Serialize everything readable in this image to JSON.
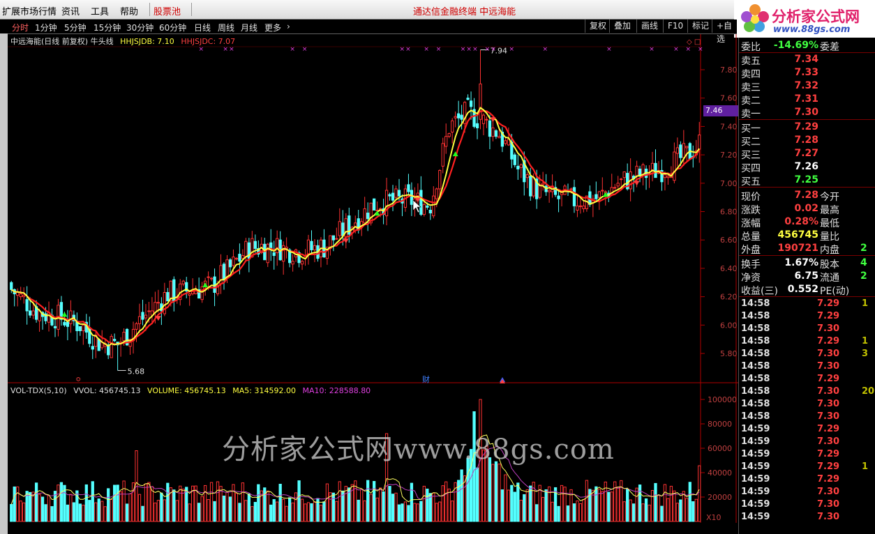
{
  "menubar": {
    "items": [
      "扩展市场行情",
      "资讯",
      "工具",
      "帮助"
    ],
    "stock_pool": "股票池",
    "title": "通达信金融终端  中远海能"
  },
  "logo": {
    "line1": "分析家公式网",
    "line2": "www.88gs.com"
  },
  "periods": [
    "分时",
    "1分钟",
    "5分钟",
    "15分钟",
    "30分钟",
    "60分钟",
    "日线",
    "周线",
    "月线",
    "更多"
  ],
  "toolbar_buttons": [
    "复权",
    "叠加",
    "画线",
    "F10",
    "标记",
    "+自选"
  ],
  "chart_info": {
    "name": "中远海能(日线 前复权) 牛头线",
    "hh_label": "HHJSJDB: 7.10",
    "hc_label": "HHJSJDC: 7.07"
  },
  "vol_info": {
    "name": "VOL-TDX(5,10)",
    "vvol": "VVOL: 456745.13",
    "volume": "VOLUME: 456745.13",
    "ma5": "MA5: 314592.00",
    "ma10": "MA10: 228588.80"
  },
  "price_axis": [
    "7.80",
    "7.60",
    "7.40",
    "7.20",
    "7.00",
    "6.80",
    "6.60",
    "6.40",
    "6.20",
    "6.00",
    "5.80"
  ],
  "vol_axis": [
    "100000",
    "80000",
    "60000",
    "40000",
    "20000"
  ],
  "vol_unit": "X10",
  "price_tag": "7.46",
  "annotations": {
    "high": "7.94",
    "low": "5.68",
    "cai": "财"
  },
  "watermark": "分析家公式网www.88gs.com",
  "quote": {
    "weibi_label": "委比",
    "weibi_value": "-14.69%",
    "weicha_label": "委差",
    "asks": [
      {
        "label": "卖五",
        "price": "7.34"
      },
      {
        "label": "卖四",
        "price": "7.33"
      },
      {
        "label": "卖三",
        "price": "7.32"
      },
      {
        "label": "卖二",
        "price": "7.31"
      },
      {
        "label": "卖一",
        "price": "7.30"
      }
    ],
    "bids": [
      {
        "label": "买一",
        "price": "7.29"
      },
      {
        "label": "买二",
        "price": "7.28"
      },
      {
        "label": "买三",
        "price": "7.27"
      },
      {
        "label": "买四",
        "price": "7.26"
      },
      {
        "label": "买五",
        "price": "7.25"
      }
    ],
    "stats": [
      {
        "l": "现价",
        "v": "7.28",
        "l2": "今开",
        "v2": ""
      },
      {
        "l": "涨跌",
        "v": "0.02",
        "l2": "最高",
        "v2": ""
      },
      {
        "l": "涨幅",
        "v": "0.28%",
        "l2": "最低",
        "v2": ""
      },
      {
        "l": "总量",
        "v": "456745",
        "l2": "量比",
        "v2": ""
      },
      {
        "l": "外盘",
        "v": "190721",
        "l2": "内盘",
        "v2": "2"
      },
      {
        "l": "换手",
        "v": "1.67%",
        "l2": "股本",
        "v2": "4"
      },
      {
        "l": "净资",
        "v": "6.75",
        "l2": "流通",
        "v2": "2"
      },
      {
        "l": "收益(三)",
        "v": "0.552",
        "l2": "PE(动)",
        "v2": ""
      }
    ],
    "ticks": [
      {
        "t": "14:58",
        "p": "7.29",
        "q": "1"
      },
      {
        "t": "14:58",
        "p": "7.29",
        "q": ""
      },
      {
        "t": "14:58",
        "p": "7.30",
        "q": ""
      },
      {
        "t": "14:58",
        "p": "7.29",
        "q": "1"
      },
      {
        "t": "14:58",
        "p": "7.30",
        "q": "3"
      },
      {
        "t": "14:58",
        "p": "7.30",
        "q": ""
      },
      {
        "t": "14:58",
        "p": "7.29",
        "q": ""
      },
      {
        "t": "14:58",
        "p": "7.30",
        "q": "20"
      },
      {
        "t": "14:58",
        "p": "7.30",
        "q": ""
      },
      {
        "t": "14:58",
        "p": "7.30",
        "q": ""
      },
      {
        "t": "14:59",
        "p": "7.29",
        "q": ""
      },
      {
        "t": "14:59",
        "p": "7.30",
        "q": ""
      },
      {
        "t": "14:59",
        "p": "7.29",
        "q": ""
      },
      {
        "t": "14:59",
        "p": "7.29",
        "q": "1"
      },
      {
        "t": "14:59",
        "p": "7.29",
        "q": ""
      },
      {
        "t": "14:59",
        "p": "7.30",
        "q": ""
      },
      {
        "t": "14:59",
        "p": "7.30",
        "q": ""
      },
      {
        "t": "14:59",
        "p": "7.30",
        "q": ""
      }
    ]
  },
  "colors": {
    "up": "#ff3232",
    "down": "#54ffff",
    "ma_yellow": "#ffff40",
    "ma_red": "#ff2020",
    "purple": "#c040c0"
  }
}
